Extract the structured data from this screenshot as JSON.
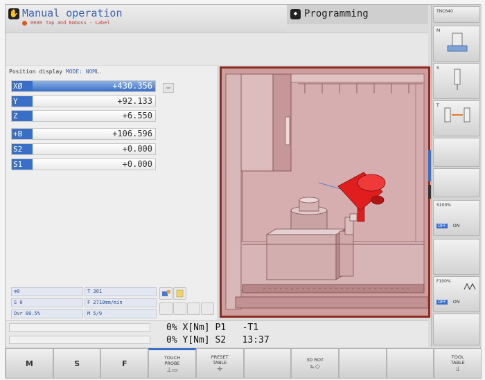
{
  "header": {
    "mode_title": "Manual operation",
    "mode_subtitle": "Tap and Emboss - Label",
    "mode_error_code": "0030",
    "program_title": "Programming"
  },
  "position_display": {
    "heading": "Position display",
    "mode_label": "MODE: NOML.",
    "axes": [
      {
        "label": "XØ",
        "value": "+430.356",
        "active": true
      },
      {
        "label": "Y",
        "value": "+92.133",
        "active": false
      },
      {
        "label": "Z",
        "value": "+6.550",
        "active": false
      },
      {
        "label": "+B",
        "value": "+106.596",
        "active": false
      },
      {
        "label": "S2",
        "value": "+0.000",
        "active": false
      },
      {
        "label": "S1",
        "value": "+0.000",
        "active": false
      }
    ]
  },
  "status": {
    "cells": [
      {
        "text": "⊕0"
      },
      {
        "text": "T 301"
      },
      {
        "text": "S 0"
      },
      {
        "text": "F 2710mm/min"
      },
      {
        "text": "Ovr 80.5%"
      },
      {
        "text": "M 5/9"
      }
    ]
  },
  "info_bar": {
    "line1": "0% X[Nm] P1   -T1",
    "line2": "0% Y[Nm] S2   13:37"
  },
  "softkeys": [
    {
      "label": "M",
      "big": true
    },
    {
      "label": "S",
      "big": true
    },
    {
      "label": "F",
      "big": true
    },
    {
      "label": "TOUCH\nPROBE",
      "big": false,
      "selected": true
    },
    {
      "label": "PRESET\nTABLE",
      "big": false
    },
    {
      "label": "",
      "big": false
    },
    {
      "label": "3D ROT",
      "big": false
    },
    {
      "label": "",
      "big": false
    },
    {
      "label": "",
      "big": false
    },
    {
      "label": "TOOL\nTABLE",
      "big": false
    }
  ],
  "vertical_softkeys": [
    {
      "label": "TNC640",
      "tag": "top"
    },
    {
      "label": "M",
      "tag": "m"
    },
    {
      "label": "S",
      "tag": "s"
    },
    {
      "label": "T",
      "tag": "t"
    },
    {
      "label": "",
      "tag": "blank1"
    },
    {
      "label": "",
      "tag": "blank2"
    },
    {
      "label": "S100%",
      "tag": "s-ovr"
    },
    {
      "label": "",
      "tag": "blank3"
    },
    {
      "label": "F100%",
      "tag": "f-ovr"
    },
    {
      "label": "",
      "tag": "blank4"
    }
  ],
  "override": {
    "off_label": "OFF",
    "on_label": "ON",
    "spindle_label": "S100%",
    "feed_label": "F100%"
  }
}
